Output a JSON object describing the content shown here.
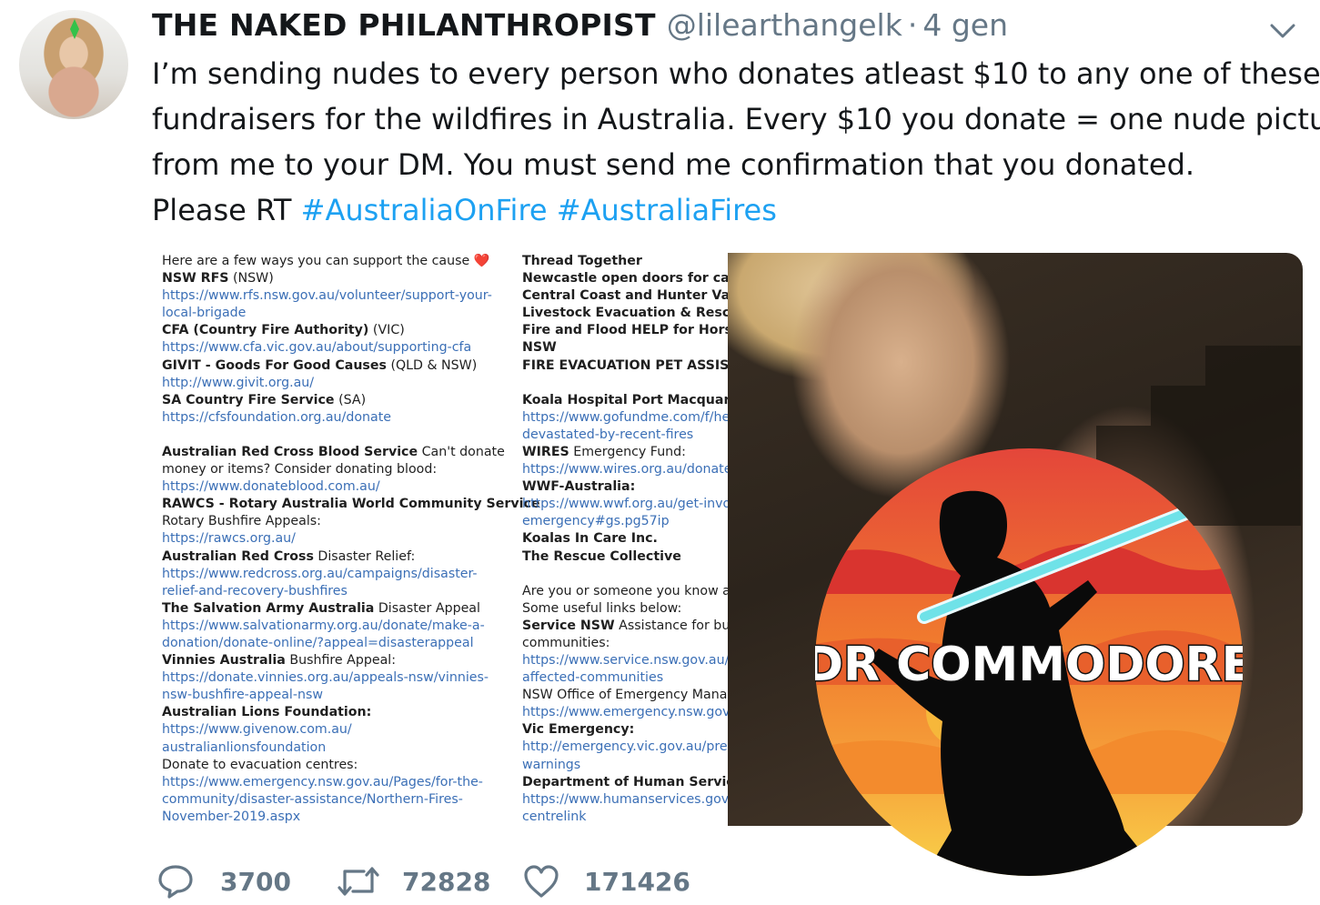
{
  "tweet": {
    "display_name": "THE NAKED PHILANTHROPIST",
    "handle": "@lilearthangelk",
    "separator": "·",
    "time": "4 gen",
    "text_lines": [
      "I’m sending nudes to every person who donates atleast $10 to any one of these",
      "fundraisers for the wildfires in Australia. Every $10 you donate = one nude picture",
      "from me to your DM. You must send me confirmation that you donated."
    ],
    "last_line_prefix": "Please RT ",
    "hashtags": [
      "#AustraliaOnFire",
      "#AustraliaFires"
    ]
  },
  "doc": {
    "col1": [
      {
        "t": "Here are a few ways you can support the cause ❤️",
        "s": "n"
      },
      {
        "t": "NSW RFS",
        "s": "b",
        "r": " (NSW)"
      },
      {
        "t": "https://www.rfs.nsw.gov.au/volunteer/support-your-",
        "s": "u"
      },
      {
        "t": "local-brigade",
        "s": "u"
      },
      {
        "t": "CFA (Country Fire Authority)",
        "s": "b",
        "r": " (VIC)"
      },
      {
        "t": "https://www.cfa.vic.gov.au/about/supporting-cfa",
        "s": "u"
      },
      {
        "t": "GIVIT - Goods For Good Causes",
        "s": "b",
        "r": " (QLD & NSW)"
      },
      {
        "t": "http://www.givit.org.au/",
        "s": "u"
      },
      {
        "t": "SA Country Fire Service",
        "s": "b",
        "r": " (SA)"
      },
      {
        "t": "https://cfsfoundation.org.au/donate",
        "s": "u"
      },
      {
        "t": "",
        "s": "gap"
      },
      {
        "t": "Australian Red Cross Blood Service",
        "s": "b",
        "r": " Can't donate"
      },
      {
        "t": "money or items? Consider donating blood:",
        "s": "n"
      },
      {
        "t": "https://www.donateblood.com.au/",
        "s": "u"
      },
      {
        "t": "RAWCS - Rotary Australia World Community Service",
        "s": "b"
      },
      {
        "t": "Rotary Bushfire Appeals:",
        "s": "n"
      },
      {
        "t": "https://rawcs.org.au/",
        "s": "u"
      },
      {
        "t": "Australian Red Cross",
        "s": "b",
        "r": " Disaster Relief:"
      },
      {
        "t": "https://www.redcross.org.au/campaigns/disaster-",
        "s": "u"
      },
      {
        "t": "relief-and-recovery-bushfires",
        "s": "u"
      },
      {
        "t": "The Salvation Army Australia",
        "s": "b",
        "r": " Disaster Appeal"
      },
      {
        "t": "https://www.salvationarmy.org.au/donate/make-a-",
        "s": "u"
      },
      {
        "t": "donation/donate-online/?appeal=disasterappeal",
        "s": "u"
      },
      {
        "t": "Vinnies Australia",
        "s": "b",
        "r": " Bushfire Appeal:"
      },
      {
        "t": "https://donate.vinnies.org.au/appeals-nsw/vinnies-",
        "s": "u"
      },
      {
        "t": "nsw-bushfire-appeal-nsw",
        "s": "u"
      },
      {
        "t": "Australian Lions Foundation:",
        "s": "b"
      },
      {
        "t": "https://www.givenow.com.au/",
        "s": "u"
      },
      {
        "t": "australianlionsfoundation",
        "s": "u"
      },
      {
        "t": "Donate to evacuation centres:",
        "s": "n"
      },
      {
        "t": "https://www.emergency.nsw.gov.au/Pages/for-the-",
        "s": "u"
      },
      {
        "t": "community/disaster-assistance/Northern-Fires-",
        "s": "u"
      },
      {
        "t": "November-2019.aspx",
        "s": "u"
      }
    ],
    "col2": [
      {
        "t": "Thread Together",
        "s": "b"
      },
      {
        "t": "Newcastle open doors for catastro",
        "s": "b"
      },
      {
        "t": "Central Coast and Hunter Valley H",
        "s": "b"
      },
      {
        "t": "Livestock Evacuation & Rescue Aid",
        "s": "b"
      },
      {
        "t": "Fire and Flood HELP for Horses Mi",
        "s": "b"
      },
      {
        "t": "NSW",
        "s": "b"
      },
      {
        "t": "FIRE EVACUATION PET ASSISTANC",
        "s": "b"
      },
      {
        "t": "",
        "s": "gap"
      },
      {
        "t": "Koala Hospital Port Macquarie",
        "s": "b"
      },
      {
        "t": "https://www.gofundme.com/f/help-",
        "s": "u"
      },
      {
        "t": "devastated-by-recent-fires",
        "s": "u"
      },
      {
        "t": "WIRES",
        "s": "b",
        "r": " Emergency Fund:"
      },
      {
        "t": "https://www.wires.org.au/donate/en",
        "s": "u"
      },
      {
        "t": "WWF-Australia:",
        "s": "b"
      },
      {
        "t": "https://www.wwf.org.au/get-involve",
        "s": "u"
      },
      {
        "t": "emergency#gs.pg57ip",
        "s": "u"
      },
      {
        "t": "Koalas In Care Inc.",
        "s": "b"
      },
      {
        "t": "The Rescue Collective",
        "s": "b"
      },
      {
        "t": "",
        "s": "gap"
      },
      {
        "t": "Are you or someone you know affec",
        "s": "n"
      },
      {
        "t": "Some useful links below:",
        "s": "n"
      },
      {
        "t": "Service NSW",
        "s": "b",
        "r": " Assistance for bushfi"
      },
      {
        "t": "communities:",
        "s": "n"
      },
      {
        "t": "https://www.service.nsw.gov.au/ass",
        "s": "u"
      },
      {
        "t": "affected-communities",
        "s": "u"
      },
      {
        "t": "NSW Office of Emergency Manager",
        "s": "n"
      },
      {
        "t": "https://www.emergency.nsw.gov.au",
        "s": "u"
      },
      {
        "t": "Vic Emergency:",
        "s": "b"
      },
      {
        "t": "http://emergency.vic.gov.au/prepare",
        "s": "u"
      },
      {
        "t": "warnings",
        "s": "u"
      },
      {
        "t": "Department of Human Services:",
        "s": "b"
      },
      {
        "t": "https://www.humanservices.gov.au/",
        "s": "u"
      },
      {
        "t": "centrelink",
        "s": "u"
      }
    ]
  },
  "watermark": {
    "text": "DR COMMODORE"
  },
  "actions": {
    "reply_icon": "reply-icon",
    "reply_count": "3700",
    "retweet_icon": "retweet-icon",
    "retweet_count": "72828",
    "like_icon": "heart-icon",
    "like_count": "171426"
  },
  "colors": {
    "link": "#1da1f2",
    "muted": "#657786",
    "doc_link": "#3b6fb6"
  }
}
